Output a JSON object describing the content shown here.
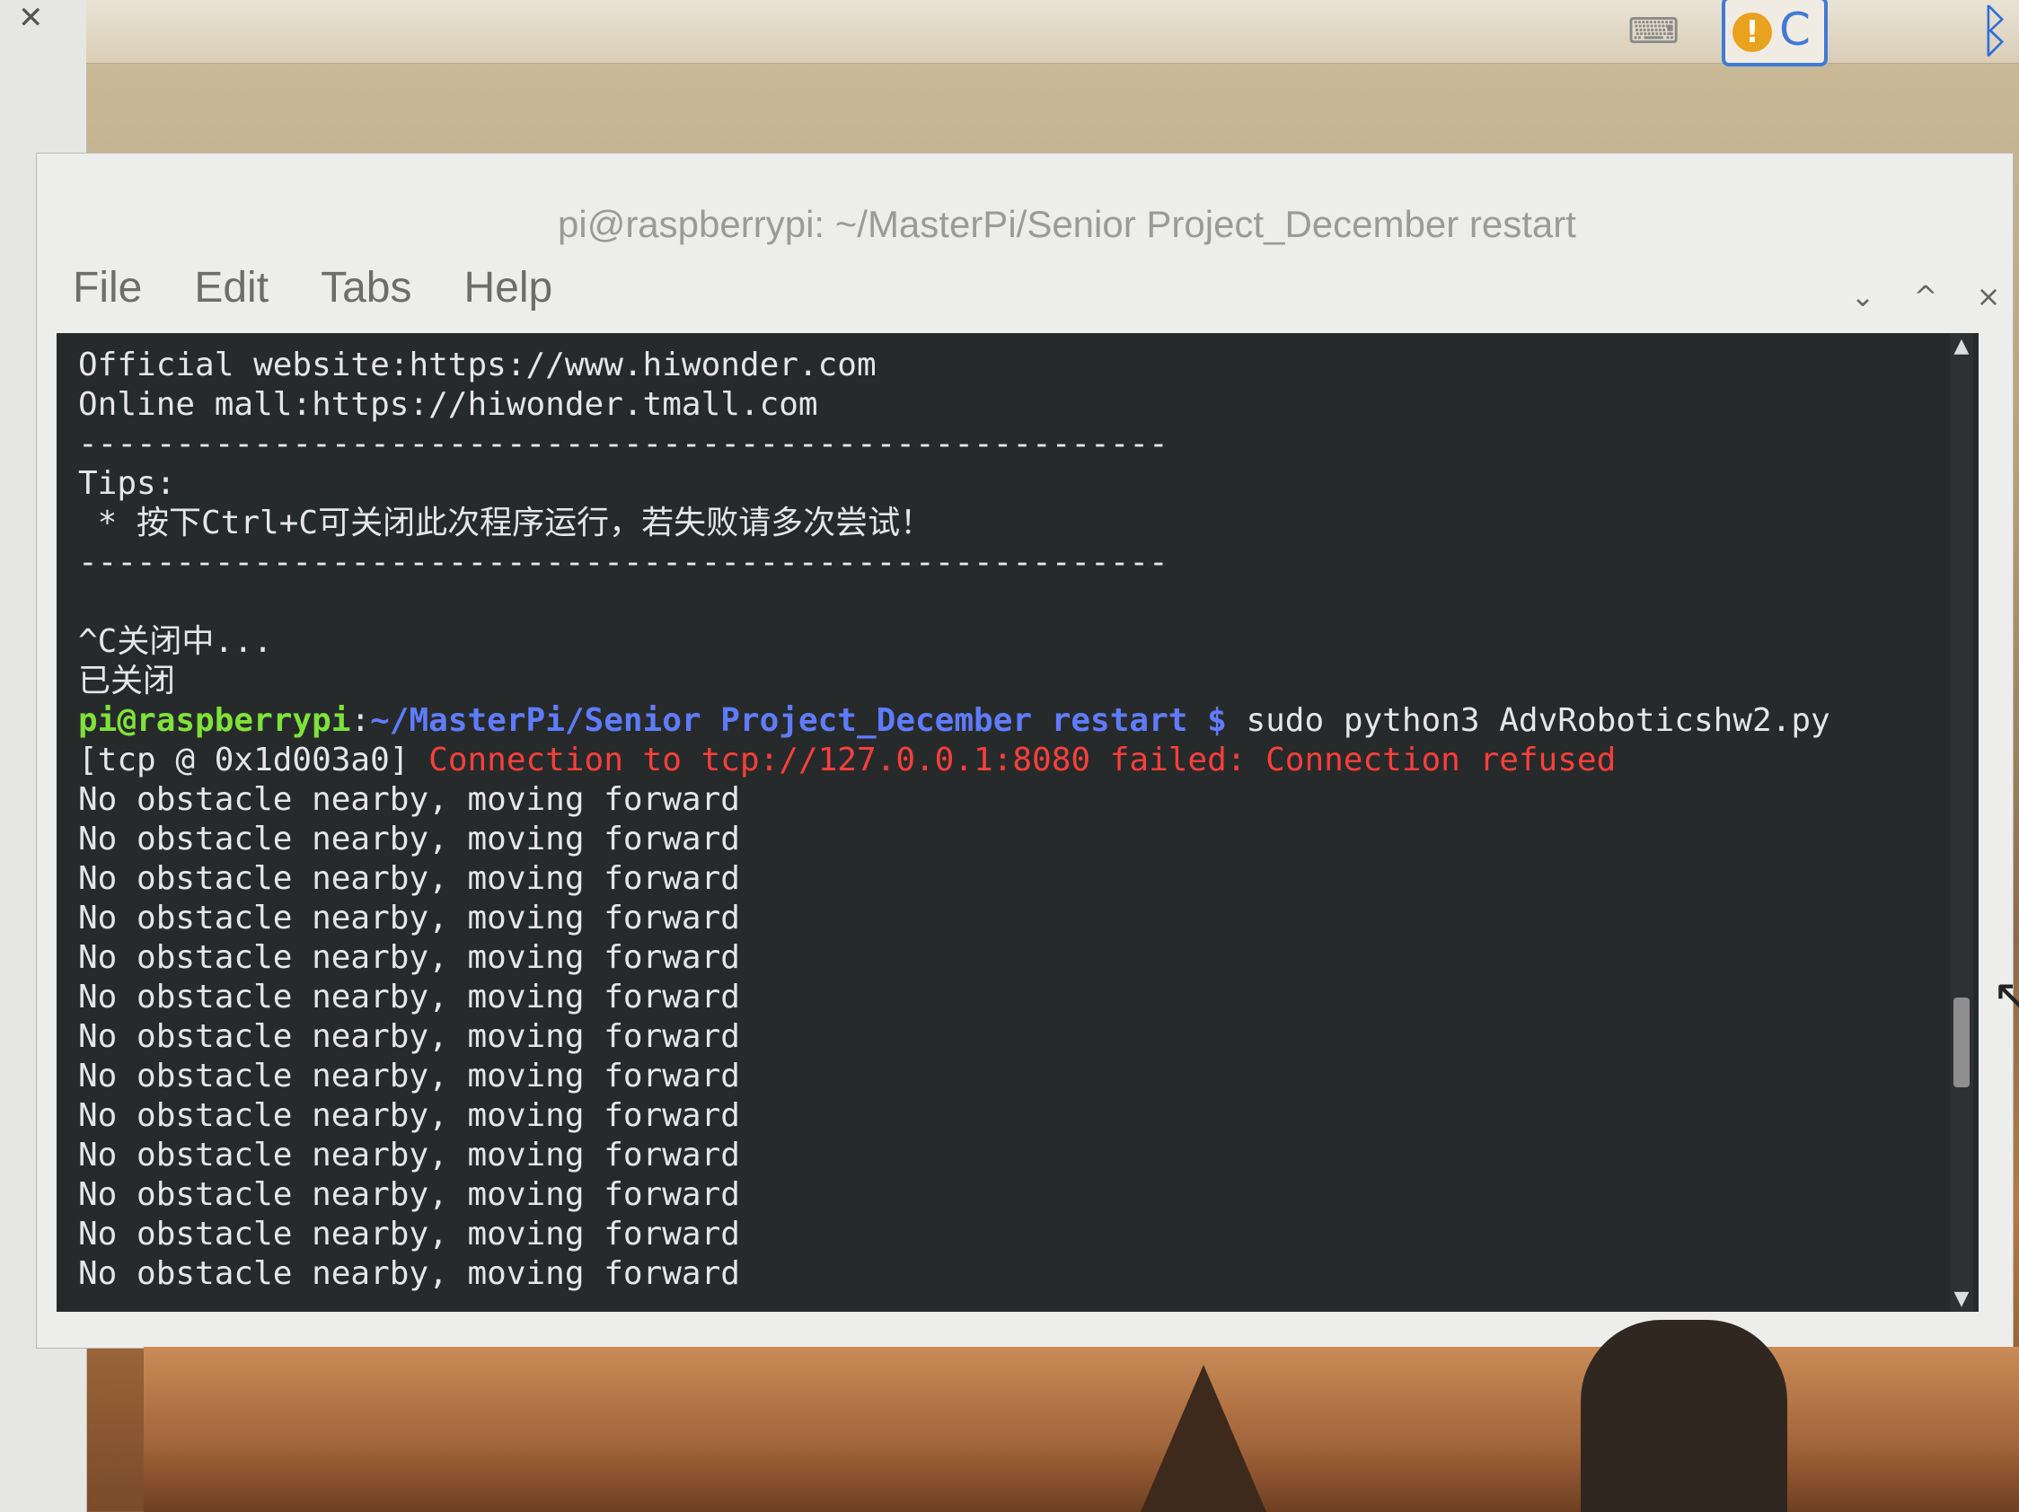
{
  "window": {
    "title": "pi@raspberrypi: ~/MasterPi/Senior Project_December restart",
    "controls": {
      "minimize": "⌄",
      "maximize": "^",
      "close": "×"
    }
  },
  "menu": {
    "file": "File",
    "edit": "Edit",
    "tabs": "Tabs",
    "help": "Help"
  },
  "tray": {
    "keyboard_icon": "keyboard-icon",
    "update_icon": "update-warning-icon",
    "bluetooth_icon": "bluetooth-icon",
    "update_warn": "!",
    "update_c": "C"
  },
  "terminal": {
    "lines_top": [
      "Official website:https://www.hiwonder.com",
      "Online mall:https://hiwonder.tmall.com",
      "--------------------------------------------------------",
      "Tips:",
      " * 按下Ctrl+C可关闭此次程序运行，若失败请多次尝试！",
      "--------------------------------------------------------",
      "",
      "^C关闭中...",
      "已关闭"
    ],
    "prompt": {
      "user": "pi@raspberrypi",
      "sep": ":",
      "path": "~/MasterPi/Senior Project_December restart $",
      "command": " sudo python3 AdvRoboticshw2.py"
    },
    "error": {
      "prefix": "[tcp @ 0x1d003a0] ",
      "message": "Connection to tcp://127.0.0.1:8080 failed: Connection refused"
    },
    "output_lines": [
      "No obstacle nearby, moving forward",
      "No obstacle nearby, moving forward",
      "No obstacle nearby, moving forward",
      "No obstacle nearby, moving forward",
      "No obstacle nearby, moving forward",
      "No obstacle nearby, moving forward",
      "No obstacle nearby, moving forward",
      "No obstacle nearby, moving forward",
      "No obstacle nearby, moving forward",
      "No obstacle nearby, moving forward",
      "No obstacle nearby, moving forward",
      "No obstacle nearby, moving forward",
      "No obstacle nearby, moving forward"
    ]
  },
  "colors": {
    "prompt_user": "#7fe23a",
    "prompt_path": "#5f7cff",
    "error": "#ff3f3a",
    "terminal_bg": "#272a2b"
  }
}
